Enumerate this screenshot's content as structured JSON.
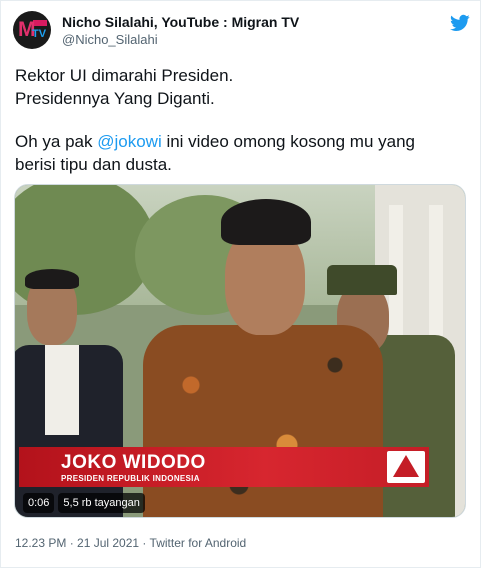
{
  "author": {
    "display_name": "Nicho Silalahi, YouTube : Migran TV",
    "handle": "@Nicho_Silalahi",
    "avatar_text": "MTV"
  },
  "tweet": {
    "line1": "Rektor UI dimarahi Presiden.",
    "line2": "Presidennya Yang Diganti.",
    "line3_before": "Oh ya pak ",
    "mention": "@jokowi",
    "line3_after": " ini video omong kosong mu yang",
    "line4": "berisi tipu dan dusta."
  },
  "video": {
    "lower_third_name": "JOKO WIDODO",
    "lower_third_title": "PRESIDEN REPUBLIK INDONESIA",
    "duration": "0:06",
    "views": "5,5 rb tayangan"
  },
  "meta": {
    "timestamp": "12.23 PM · 21 Jul 2021 · Twitter for Android"
  },
  "icons": {
    "twitter": "twitter-bird-icon",
    "channel": "channel-logo-icon"
  },
  "colors": {
    "mention": "#1d9bf0",
    "twitter_blue": "#1d9bf0",
    "lower_third_red": "#c41d26"
  }
}
